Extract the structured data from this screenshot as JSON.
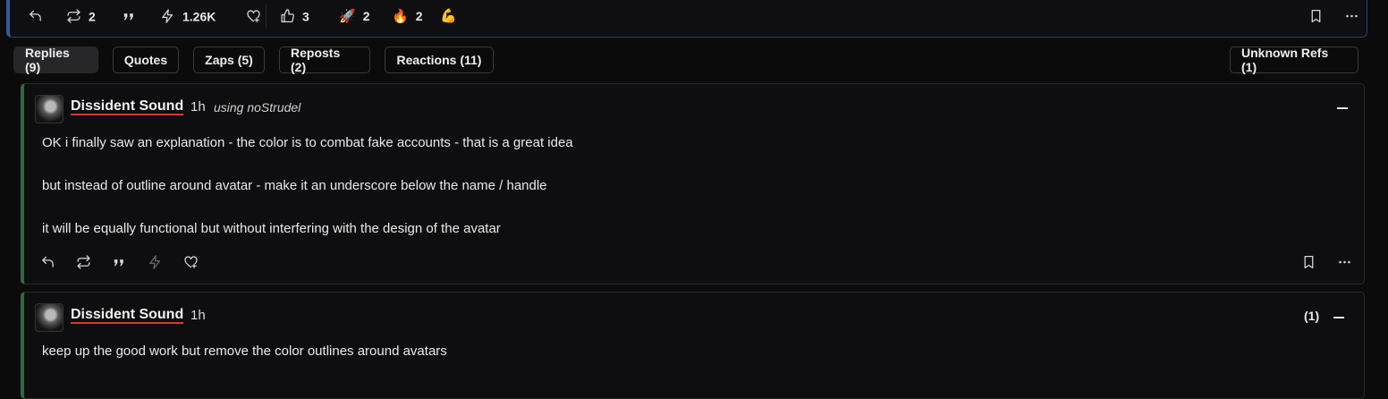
{
  "top_actions": {
    "reposts": "2",
    "zap_amount": "1.26K",
    "likes": "3",
    "rocket_emoji": "🚀",
    "rocket_count": "2",
    "fire_emoji": "🔥",
    "fire_count": "2",
    "flex_emoji": "💪"
  },
  "tabs": [
    {
      "label": "Replies (9)"
    },
    {
      "label": "Quotes"
    },
    {
      "label": "Zaps (5)"
    },
    {
      "label": "Reposts (2)"
    },
    {
      "label": "Reactions (11)"
    },
    {
      "label": "Unknown Refs (1)"
    }
  ],
  "replies": [
    {
      "author": "Dissident Sound",
      "time": "1h",
      "client": "using noStrudel",
      "lines": [
        "OK i finally saw an explanation - the color is to combat fake accounts - that is a great idea",
        "but instead of outline around avatar - make it an underscore below the name / handle",
        "it will be equally functional but without interfering with the design of the avatar"
      ]
    },
    {
      "author": "Dissident Sound",
      "time": "1h",
      "ref_count": "(1)",
      "lines": [
        "keep up the good work but remove the color outlines around avatars"
      ]
    }
  ],
  "colors": {
    "accent_blue": "#355a9a",
    "reply_border_green": "#2e6b3f",
    "name_underline_red": "#d23c2a"
  }
}
